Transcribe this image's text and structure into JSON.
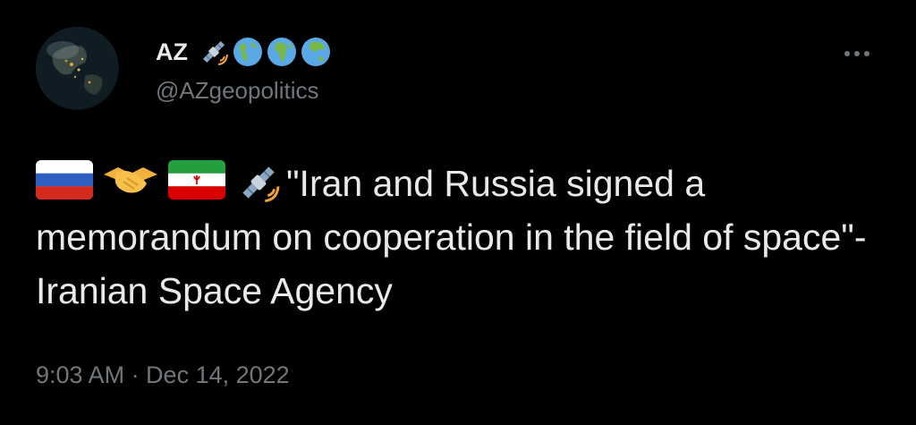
{
  "author": {
    "display_name": "AZ",
    "handle": "@AZgeopolitics",
    "name_badges": [
      "satellite-icon",
      "globe-americas-icon",
      "globe-africa-icon",
      "globe-asia-icon"
    ]
  },
  "tweet": {
    "emoji_prefix": [
      "russia-flag-icon",
      "handshake-icon",
      "iran-flag-icon",
      "satellite-icon"
    ],
    "text": "\"Iran and Russia signed a memorandum on cooperation in the field of space\"-Iranian Space Agency"
  },
  "meta": {
    "timestamp": "9:03 AM · Dec 14, 2022"
  },
  "colors": {
    "background": "#000000",
    "primary_text": "#e7e9ea",
    "secondary_text": "#71767b"
  }
}
